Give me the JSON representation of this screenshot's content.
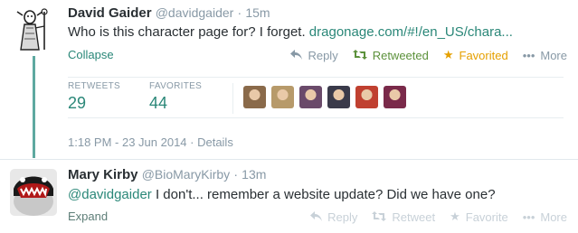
{
  "tweets": [
    {
      "fullname": "David Gaider",
      "username": "@davidgaider",
      "time": "15m",
      "text": "Who is this character page for? I forget.",
      "link": "dragonage.com/#!/en_US/chara...",
      "expand_label": "Collapse",
      "actions": {
        "reply": "Reply",
        "retweet": "Retweeted",
        "favorite": "Favorited",
        "more": "More"
      },
      "stats": {
        "retweets_label": "RETWEETS",
        "retweets_value": "29",
        "favorites_label": "FAVORITES",
        "favorites_value": "44"
      },
      "favoriter_colors": [
        "#8a6a4a",
        "#b79a6a",
        "#6a4a6a",
        "#3a3a4a",
        "#c04030",
        "#7a2a4a"
      ],
      "timestamp": "1:18 PM - 23 Jun 2014 · Details"
    },
    {
      "fullname": "Mary Kirby",
      "username": "@BioMaryKirby",
      "time": "13m",
      "mention": "@davidgaider",
      "text": " I don't... remember a website update? Did we have one?",
      "expand_label": "Expand",
      "actions": {
        "reply": "Reply",
        "retweet": "Retweet",
        "favorite": "Favorite",
        "more": "More"
      }
    }
  ],
  "icons": {
    "reply": "reply-icon",
    "retweet": "retweet-icon",
    "favorite": "star-icon",
    "more": "ellipsis-icon"
  },
  "colors": {
    "link": "#2a8778",
    "thread": "#5ea9a0",
    "retweeted": "#5c913b",
    "favorited": "#e5a000"
  }
}
